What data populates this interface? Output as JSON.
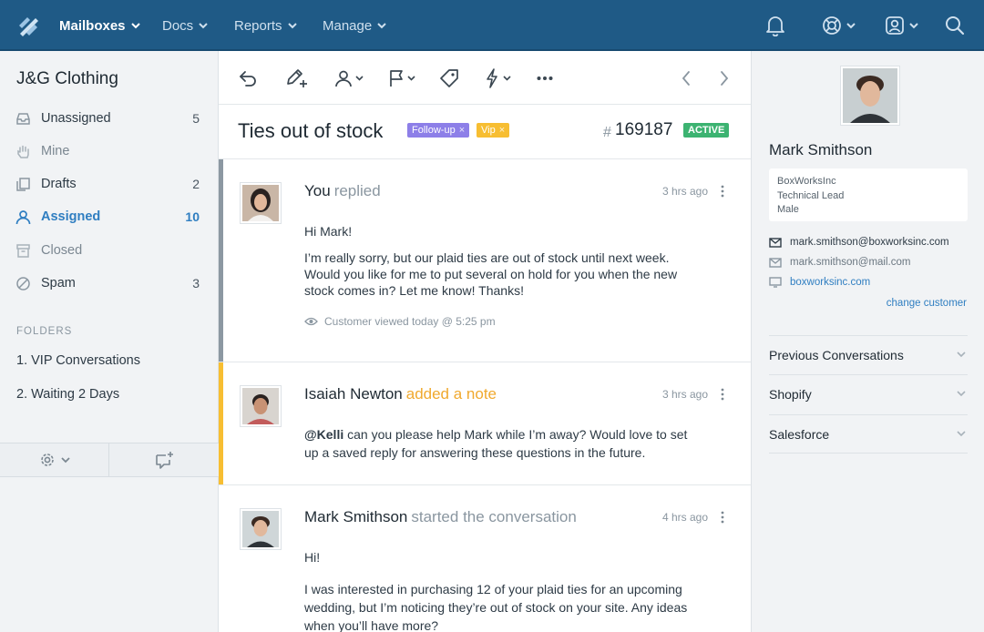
{
  "topbar": {
    "nav": [
      {
        "label": "Mailboxes",
        "active": true
      },
      {
        "label": "Docs",
        "active": false
      },
      {
        "label": "Reports",
        "active": false
      },
      {
        "label": "Manage",
        "active": false
      }
    ],
    "icons": [
      "bell-icon",
      "lifebuoy-icon",
      "user-profile-icon",
      "search-icon"
    ],
    "colors": {
      "bar": "#1f5a86",
      "active_text": "#ffffff",
      "text": "#cfe0ee"
    }
  },
  "sidebar": {
    "mailbox_name": "J&G Clothing",
    "items": [
      {
        "label": "Unassigned",
        "count": "5",
        "icon": "inbox-icon"
      },
      {
        "label": "Mine",
        "count": "",
        "icon": "hand-icon"
      },
      {
        "label": "Drafts",
        "count": "2",
        "icon": "drafts-icon"
      },
      {
        "label": "Assigned",
        "count": "10",
        "icon": "user-icon"
      },
      {
        "label": "Closed",
        "count": "",
        "icon": "archive-icon"
      },
      {
        "label": "Spam",
        "count": "3",
        "icon": "spam-icon"
      }
    ],
    "folders_heading": "FOLDERS",
    "folders": [
      "1. VIP Conversations",
      "2. Waiting 2 Days"
    ],
    "footer_icons": [
      "gear-icon",
      "new-conversation-icon"
    ]
  },
  "toolbar": {
    "icons": [
      "reply-icon",
      "note-icon",
      "assign-icon",
      "status-flag-icon",
      "tag-icon",
      "workflow-icon",
      "more-icon",
      "prev-icon",
      "next-icon"
    ]
  },
  "conversation": {
    "subject": "Ties out of stock",
    "tags": [
      {
        "label": "Follow-up",
        "color": "#8d7fe8"
      },
      {
        "label": "Vip",
        "color": "#f7be32"
      }
    ],
    "tag_remove": "×",
    "hash": "#",
    "number": "169187",
    "status": "ACTIVE",
    "threads": [
      {
        "author": "You",
        "action": "replied",
        "time": "3 hrs ago",
        "bar_color": "#8c98a2",
        "action_color": "#8a96a0",
        "paragraphs": [
          "Hi Mark!",
          "I’m really sorry, but our plaid ties are out of stock until next week. Would you like for me to put several on hold for you when the new stock comes in? Let me know! Thanks!"
        ],
        "viewed": "Customer viewed today @ 5:25 pm"
      },
      {
        "author": "Isaiah Newton",
        "action": "added a note",
        "time": "3 hrs ago",
        "bar_color": "#f7be32",
        "action_color": "#f0a92e",
        "mention": "@Kelli",
        "paragraphs": [
          " can you please help Mark while I’m away? Would love to set up a saved reply for answering these questions in the future."
        ]
      },
      {
        "author": "Mark Smithson",
        "action": "started the conversation",
        "time": "4 hrs ago",
        "bar_color": "#ffffff",
        "action_color": "#8a96a0",
        "paragraphs": [
          "Hi!",
          "I was interested in purchasing 12 of your plaid ties for an upcoming wedding, but I’m noticing they’re out of stock on your site. Any ideas when you’ll have more?"
        ]
      }
    ]
  },
  "customer": {
    "name": "Mark Smithson",
    "company": "BoxWorksInc",
    "title": "Technical Lead",
    "gender": "Male",
    "emails": [
      "mark.smithson@boxworksinc.com",
      "mark.smithson@mail.com"
    ],
    "website": "boxworksinc.com",
    "change_link": "change customer",
    "sections": [
      "Previous Conversations",
      "Shopify",
      "Salesforce"
    ]
  }
}
